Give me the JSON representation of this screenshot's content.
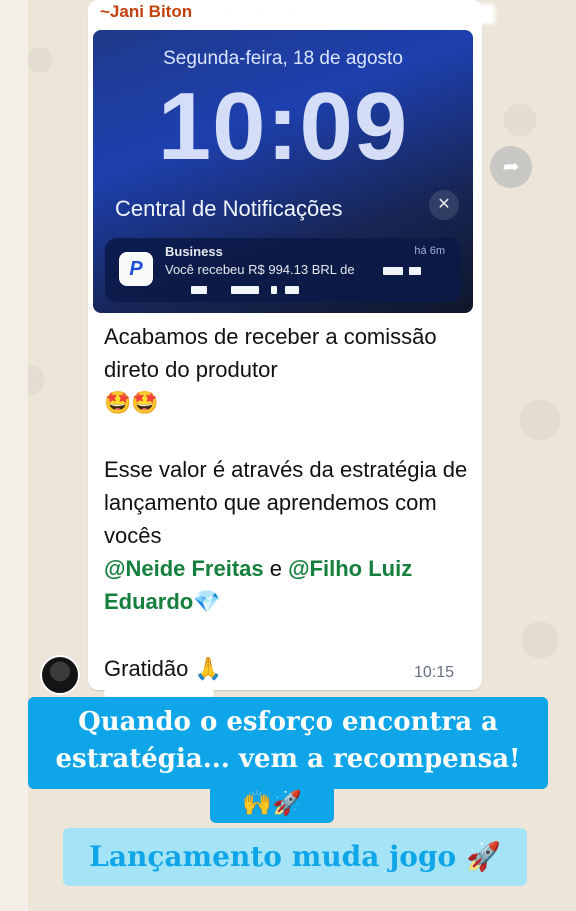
{
  "colors": {
    "sender": "#c2410c",
    "mention": "#15803d",
    "banner_primary": "#0ea5e9",
    "banner_secondary": "#a5e4f6"
  },
  "message": {
    "sender": "~Jani Biton",
    "lockscreen": {
      "date": "Segunda-feira, 18 de agosto",
      "time": "10:09",
      "notification_center": "Central de Notificações",
      "close_icon": "close-icon",
      "notification": {
        "app": "Business",
        "age": "há 6m",
        "text": "Você recebeu R$ 994.13 BRL de"
      }
    },
    "paragraph1": "Acabamos de receber a comissão direto do produtor",
    "paragraph1_emojis": "🤩🤩",
    "paragraph2_start": "Esse valor é através da estratégia de lançamento que aprendemos com vocês",
    "mention1": "@Neide Freitas",
    "connector": " e ",
    "mention2": "@Filho Luiz Eduardo",
    "mention2_emoji": "💎",
    "closing": "Gratidão",
    "closing_emoji": "🙏",
    "time": "10:15",
    "forward_icon": "forward-icon"
  },
  "captions": {
    "line1": "Quando o esforço encontra a",
    "line2": "estratégia... vem a recompensa!",
    "emojis": "🙌🚀",
    "line3": "Lançamento muda jogo 🚀"
  }
}
